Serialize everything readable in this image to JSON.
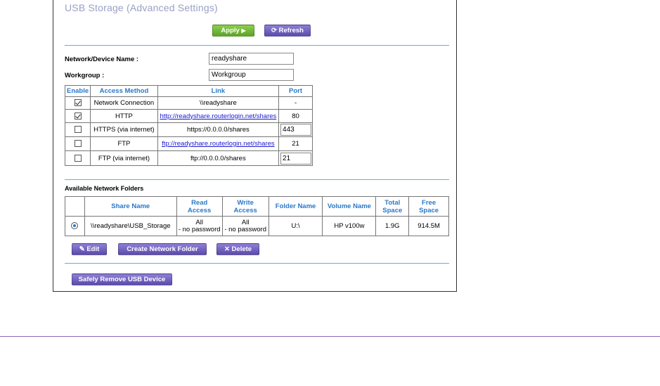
{
  "page": {
    "title": "USB Storage (Advanced Settings)",
    "apply_label": "Apply",
    "apply_arrow": "▶",
    "refresh_icon": "⟳",
    "refresh_label": "Refresh"
  },
  "device": {
    "name_label": "Network/Device Name :",
    "name_value": "readyshare",
    "workgroup_label": "Workgroup :",
    "workgroup_value": "Workgroup"
  },
  "access": {
    "headers": [
      "Enable",
      "Access Method",
      "Link",
      "Port"
    ],
    "rows": [
      {
        "enabled": true,
        "method": "Network Connection",
        "link": "\\\\readyshare",
        "link_is_url": false,
        "port": "-",
        "port_editable": false
      },
      {
        "enabled": true,
        "method": "HTTP",
        "link": "http://readyshare.routerlogin.net/shares",
        "link_is_url": true,
        "port": "80",
        "port_editable": false
      },
      {
        "enabled": false,
        "method": "HTTPS (via internet)",
        "link": "https://0.0.0.0/shares",
        "link_is_url": false,
        "port": "443",
        "port_editable": true
      },
      {
        "enabled": false,
        "method": "FTP",
        "link": "ftp://readyshare.routerlogin.net/shares",
        "link_is_url": true,
        "port": "21",
        "port_editable": false
      },
      {
        "enabled": false,
        "method": "FTP (via internet)",
        "link": "ftp://0.0.0.0/shares",
        "link_is_url": false,
        "port": "21",
        "port_editable": true
      }
    ]
  },
  "folders": {
    "section_label": "Available Network Folders",
    "headers": {
      "share_name": "Share Name",
      "read_access_1": "Read",
      "read_access_2": "Access",
      "write_access_1": "Write",
      "write_access_2": "Access",
      "folder_name": "Folder Name",
      "volume_name": "Volume Name",
      "total_space_1": "Total",
      "total_space_2": "Space",
      "free_space_1": "Free",
      "free_space_2": "Space"
    },
    "row": {
      "selected": true,
      "share_name": "\\\\readyshare\\USB_Storage",
      "read_access_1": "All",
      "read_access_2": "- no password",
      "write_access_1": "All",
      "write_access_2": "- no password",
      "folder_name": "U:\\",
      "volume_name": "HP v100w",
      "total_space": "1.9G",
      "free_space": "914.5M"
    },
    "edit_icon": "✎",
    "edit_label": "Edit",
    "create_label": "Create Network Folder",
    "delete_icon": "✕",
    "delete_label": "Delete"
  },
  "remove_label": "Safely Remove USB Device",
  "colors": {
    "header_text": "#2a78c8",
    "divider": "#6aaad8",
    "apply_button": "#6cb63a",
    "purple_button": "#6e5ec0",
    "footer_rule": "#8a64b8"
  }
}
